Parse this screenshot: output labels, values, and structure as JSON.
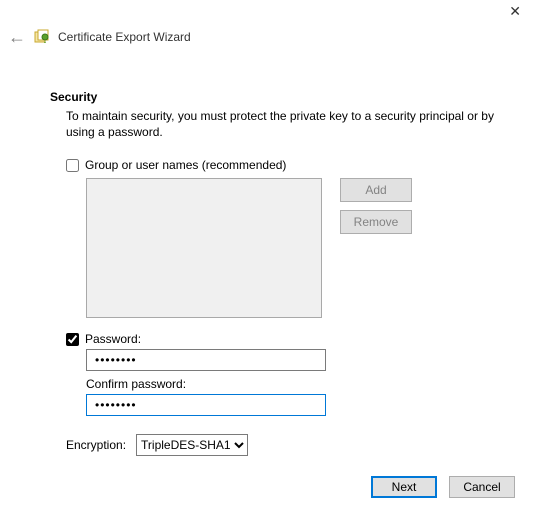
{
  "window": {
    "title": "Certificate Export Wizard"
  },
  "section": {
    "heading": "Security",
    "description": "To maintain security, you must protect the private key to a security principal or by using a password."
  },
  "group_names": {
    "label": "Group or user names (recommended)",
    "checked": false,
    "add_label": "Add",
    "remove_label": "Remove"
  },
  "password": {
    "checked": true,
    "label": "Password:",
    "value": "••••••••",
    "confirm_label": "Confirm password:",
    "confirm_value": "••••••••"
  },
  "encryption": {
    "label": "Encryption:",
    "selected": "TripleDES-SHA1"
  },
  "footer": {
    "next": "Next",
    "cancel": "Cancel"
  }
}
